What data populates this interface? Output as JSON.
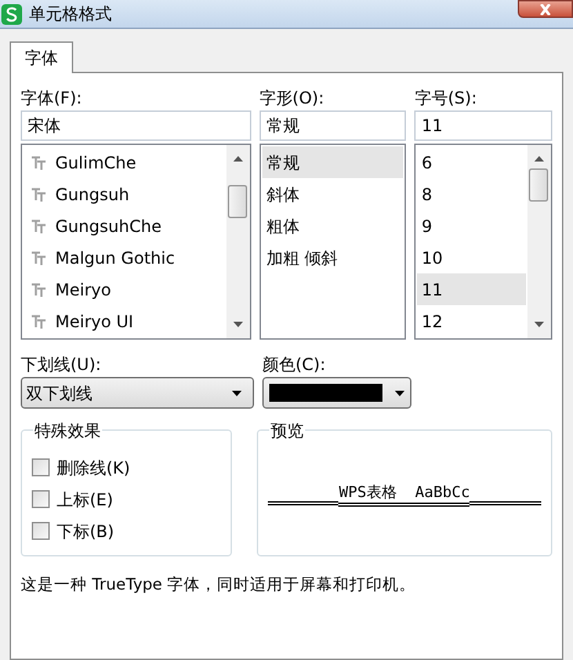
{
  "window": {
    "title": "单元格格式"
  },
  "tabs": [
    {
      "label": "字体",
      "selected": true
    }
  ],
  "font": {
    "label": "字体(F):",
    "value": "宋体",
    "items": [
      {
        "name": "GulimChe",
        "selected": false
      },
      {
        "name": "Gungsuh",
        "selected": false
      },
      {
        "name": "GungsuhChe",
        "selected": false
      },
      {
        "name": "Malgun Gothic",
        "selected": false
      },
      {
        "name": "Meiryo",
        "selected": false
      },
      {
        "name": "Meiryo UI",
        "selected": false
      }
    ]
  },
  "style": {
    "label": "字形(O):",
    "value": "常规",
    "items": [
      {
        "name": "常规",
        "selected": true
      },
      {
        "name": "斜体",
        "selected": false
      },
      {
        "name": "粗体",
        "selected": false
      },
      {
        "name": "加粗 倾斜",
        "selected": false
      }
    ]
  },
  "size": {
    "label": "字号(S):",
    "value": "11",
    "items": [
      {
        "name": "6",
        "selected": false
      },
      {
        "name": "8",
        "selected": false
      },
      {
        "name": "9",
        "selected": false
      },
      {
        "name": "10",
        "selected": false
      },
      {
        "name": "11",
        "selected": true
      },
      {
        "name": "12",
        "selected": false
      }
    ]
  },
  "underline": {
    "label": "下划线(U):",
    "value": "双下划线",
    "kind": "double"
  },
  "color": {
    "label": "颜色(C):",
    "color": "#000000"
  },
  "effects": {
    "title": "特殊效果",
    "options": [
      {
        "label": "删除线(K)",
        "checked": false
      },
      {
        "label": "上标(E)",
        "checked": false
      },
      {
        "label": "下标(B)",
        "checked": false
      }
    ]
  },
  "preview": {
    "title": "预览",
    "text": "WPS表格  AaBbCc"
  },
  "note": "这是一种 TrueType 字体，同时适用于屏幕和打印机。"
}
